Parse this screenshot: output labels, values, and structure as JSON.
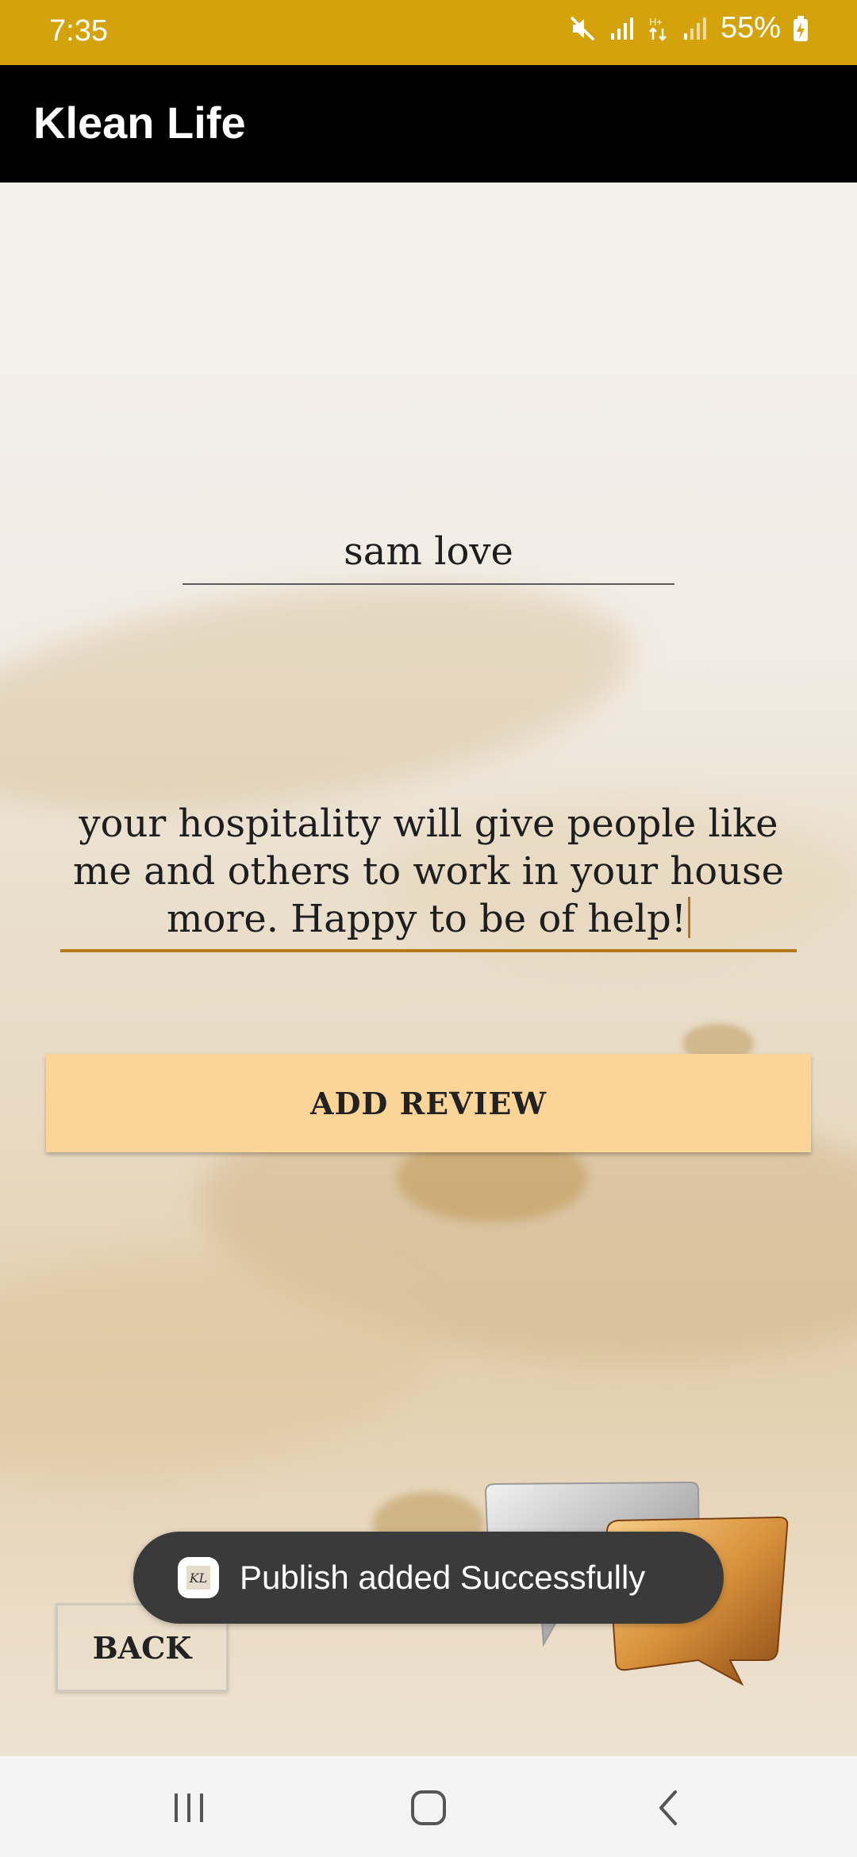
{
  "status_bar": {
    "time": "7:35",
    "battery": "55%",
    "icons": [
      "mute-icon",
      "signal-icon",
      "data-arrows-icon",
      "signal-icon",
      "battery-charging-icon"
    ]
  },
  "app_bar": {
    "title": "Klean Life"
  },
  "form": {
    "name_value": "sam love",
    "review_value": "your hospitality will give people like me and others to work in your house more. Happy to be of help!",
    "add_review_label": "ADD REVIEW",
    "back_label": "BACK"
  },
  "toast": {
    "message": "Publish added Successfully",
    "app_icon_text": "KL"
  },
  "nav_bar": {
    "icons": [
      "recent-apps-icon",
      "home-icon",
      "back-icon"
    ]
  },
  "colors": {
    "status_bar": "#d4a30c",
    "app_bar": "#000000",
    "button": "#fbd498",
    "accent_underline": "#b5791a",
    "toast": "#3a3a3a"
  }
}
